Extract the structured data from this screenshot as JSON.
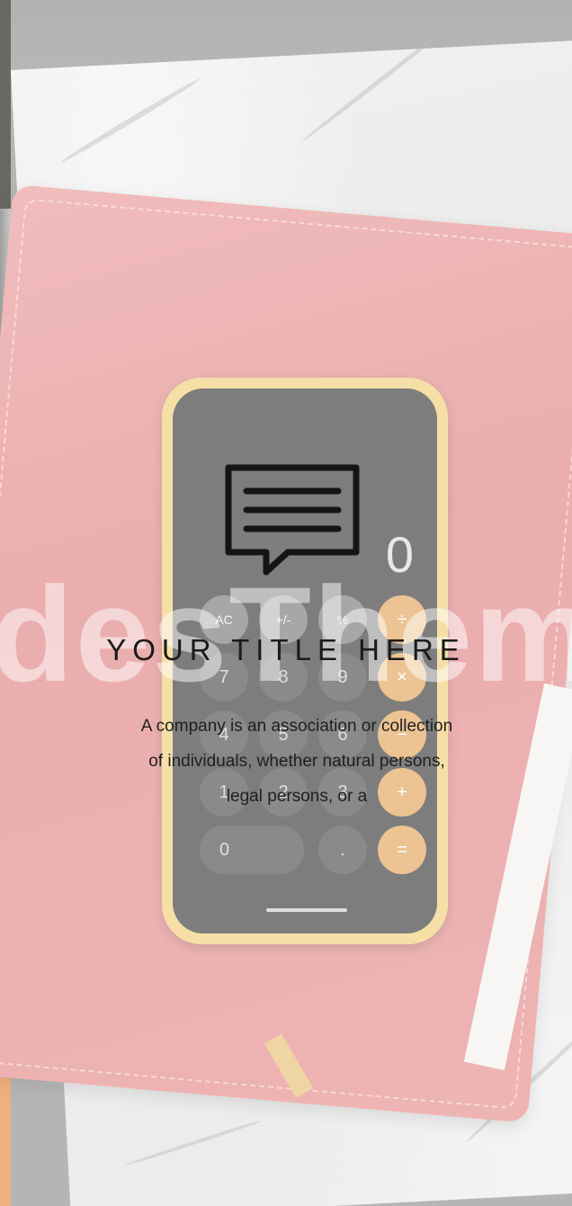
{
  "background": {
    "phone": {
      "display": "0",
      "keys": {
        "row1": [
          "AC",
          "+/-",
          "%",
          "÷"
        ],
        "row2": [
          "7",
          "8",
          "9",
          "×"
        ],
        "row3": [
          "4",
          "5",
          "6",
          "−"
        ],
        "row4": [
          "1",
          "2",
          "3",
          "+"
        ],
        "row5": [
          "0",
          ".",
          "="
        ]
      }
    },
    "watermark": "desThem"
  },
  "card": {
    "icon": "chat-bubble-lines-icon",
    "title": "YOUR TITLE HERE",
    "description_lines": [
      "A company is an association or collection",
      "of individuals, whether natural persons,",
      "legal persons, or a"
    ]
  },
  "colors": {
    "accent_orange": "#e9873a",
    "notebook_red": "#e08383",
    "phone_gold": "#f0cf7a",
    "text_dark": "#1a1a1a"
  }
}
